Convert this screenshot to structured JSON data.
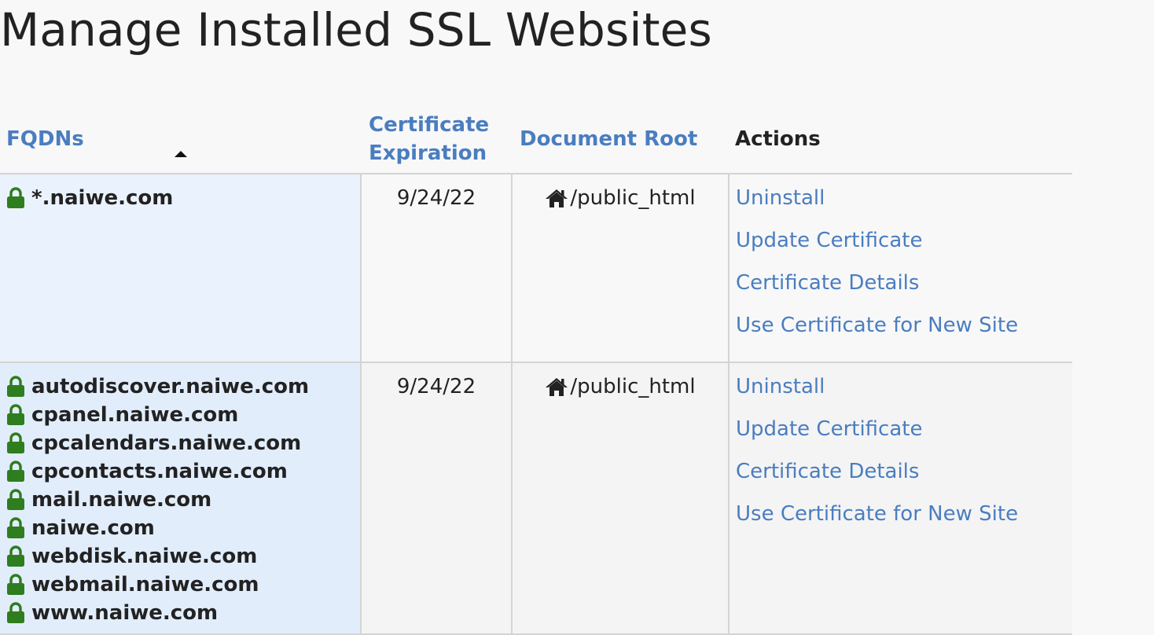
{
  "page": {
    "title": "Manage Installed SSL Websites"
  },
  "table": {
    "headers": {
      "fqdns": "FQDNs",
      "expiration": "Certificate Expiration",
      "document_root": "Document Root",
      "actions": "Actions"
    },
    "sort": {
      "column": "FQDNs",
      "direction": "ascending"
    },
    "rows": [
      {
        "fqdns": [
          "*.naiwe.com"
        ],
        "expiration": "9/24/22",
        "document_root": "/public_html",
        "actions": [
          "Uninstall",
          "Update Certificate",
          "Certificate Details",
          "Use Certificate for New Site"
        ]
      },
      {
        "fqdns": [
          "autodiscover.naiwe.com",
          "cpanel.naiwe.com",
          "cpcalendars.naiwe.com",
          "cpcontacts.naiwe.com",
          "mail.naiwe.com",
          "naiwe.com",
          "webdisk.naiwe.com",
          "webmail.naiwe.com",
          "www.naiwe.com"
        ],
        "expiration": "9/24/22",
        "document_root": "/public_html",
        "actions": [
          "Uninstall",
          "Update Certificate",
          "Certificate Details",
          "Use Certificate for New Site"
        ]
      }
    ]
  },
  "icons": {
    "fqdn_status": "lock-icon",
    "document_root_prefix": "home-icon",
    "sort_indicator": "sort-ascending-icon"
  },
  "colors": {
    "link": "#4a7dc0",
    "lock": "#2e7d1e",
    "row_highlight": "#e2edfc"
  }
}
